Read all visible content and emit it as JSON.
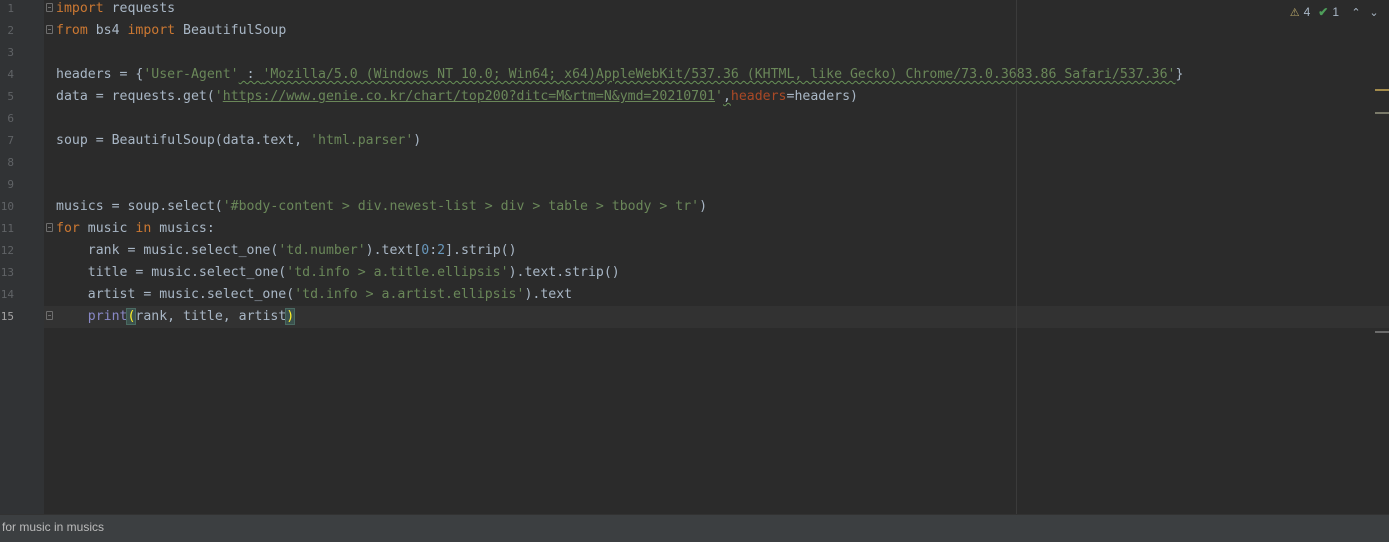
{
  "editor": {
    "line_numbers": [
      "1",
      "2",
      "3",
      "4",
      "5",
      "6",
      "7",
      "8",
      "9",
      "10",
      "11",
      "12",
      "13",
      "14",
      "15"
    ],
    "current_line": "15"
  },
  "code": {
    "l1": {
      "kw_import": "import",
      "rest": " requests"
    },
    "l2": {
      "kw_from": "from",
      "module": " bs4 ",
      "kw_import": "import",
      "rest": " BeautifulSoup"
    },
    "l4": {
      "prefix": "headers = {",
      "key": "'User-Agent'",
      "colon": " : ",
      "value": "'Mozilla/5.0 (Windows NT 10.0; Win64; x64)AppleWebKit/537.36 (KHTML, like Gecko) Chrome/73.0.3683.86 Safari/537.36'",
      "suffix": "}"
    },
    "l5": {
      "prefix": "data = requests.get(",
      "q1": "'",
      "url": "https://www.genie.co.kr/chart/top200?ditc=M&rtm=N&ymd=20210701",
      "q2": "'",
      "comma": ",",
      "param": "headers",
      "suffix": "=headers)"
    },
    "l7": {
      "prefix": "soup = BeautifulSoup(data.text, ",
      "str": "'html.parser'",
      "suffix": ")"
    },
    "l10": {
      "prefix": "musics = soup.select(",
      "str": "'#body-content > div.newest-list > div > table > tbody > tr'",
      "suffix": ")"
    },
    "l11": {
      "kw_for": "for",
      "mid": " music ",
      "kw_in": "in",
      "rest": " musics:"
    },
    "l12": {
      "prefix": "    rank = music.select_one(",
      "str": "'td.number'",
      "mid": ").text[",
      "n0": "0",
      "colon": ":",
      "n2": "2",
      "suffix": "].strip()"
    },
    "l13": {
      "prefix": "    title = music.select_one(",
      "str": "'td.info > a.title.ellipsis'",
      "suffix": ").text.strip()"
    },
    "l14": {
      "prefix": "    artist = music.select_one(",
      "str": "'td.info > a.artist.ellipsis'",
      "suffix": ").text"
    },
    "l15": {
      "indent": "    ",
      "fn": "print",
      "open": "(",
      "args": "rank, title, artist",
      "close": ")"
    }
  },
  "inspections": {
    "warnings": "4",
    "weak_warnings": "1",
    "warning_icon": "warning-triangle-icon",
    "ok_icon": "checkmark-icon"
  },
  "status": {
    "breadcrumb": "for music in musics"
  },
  "colors": {
    "background": "#2b2b2b",
    "keyword": "#cc7832",
    "string": "#6a8759",
    "number": "#6897bb",
    "parameter": "#aa4926",
    "builtin": "#8888c6",
    "text": "#a9b7c6"
  }
}
